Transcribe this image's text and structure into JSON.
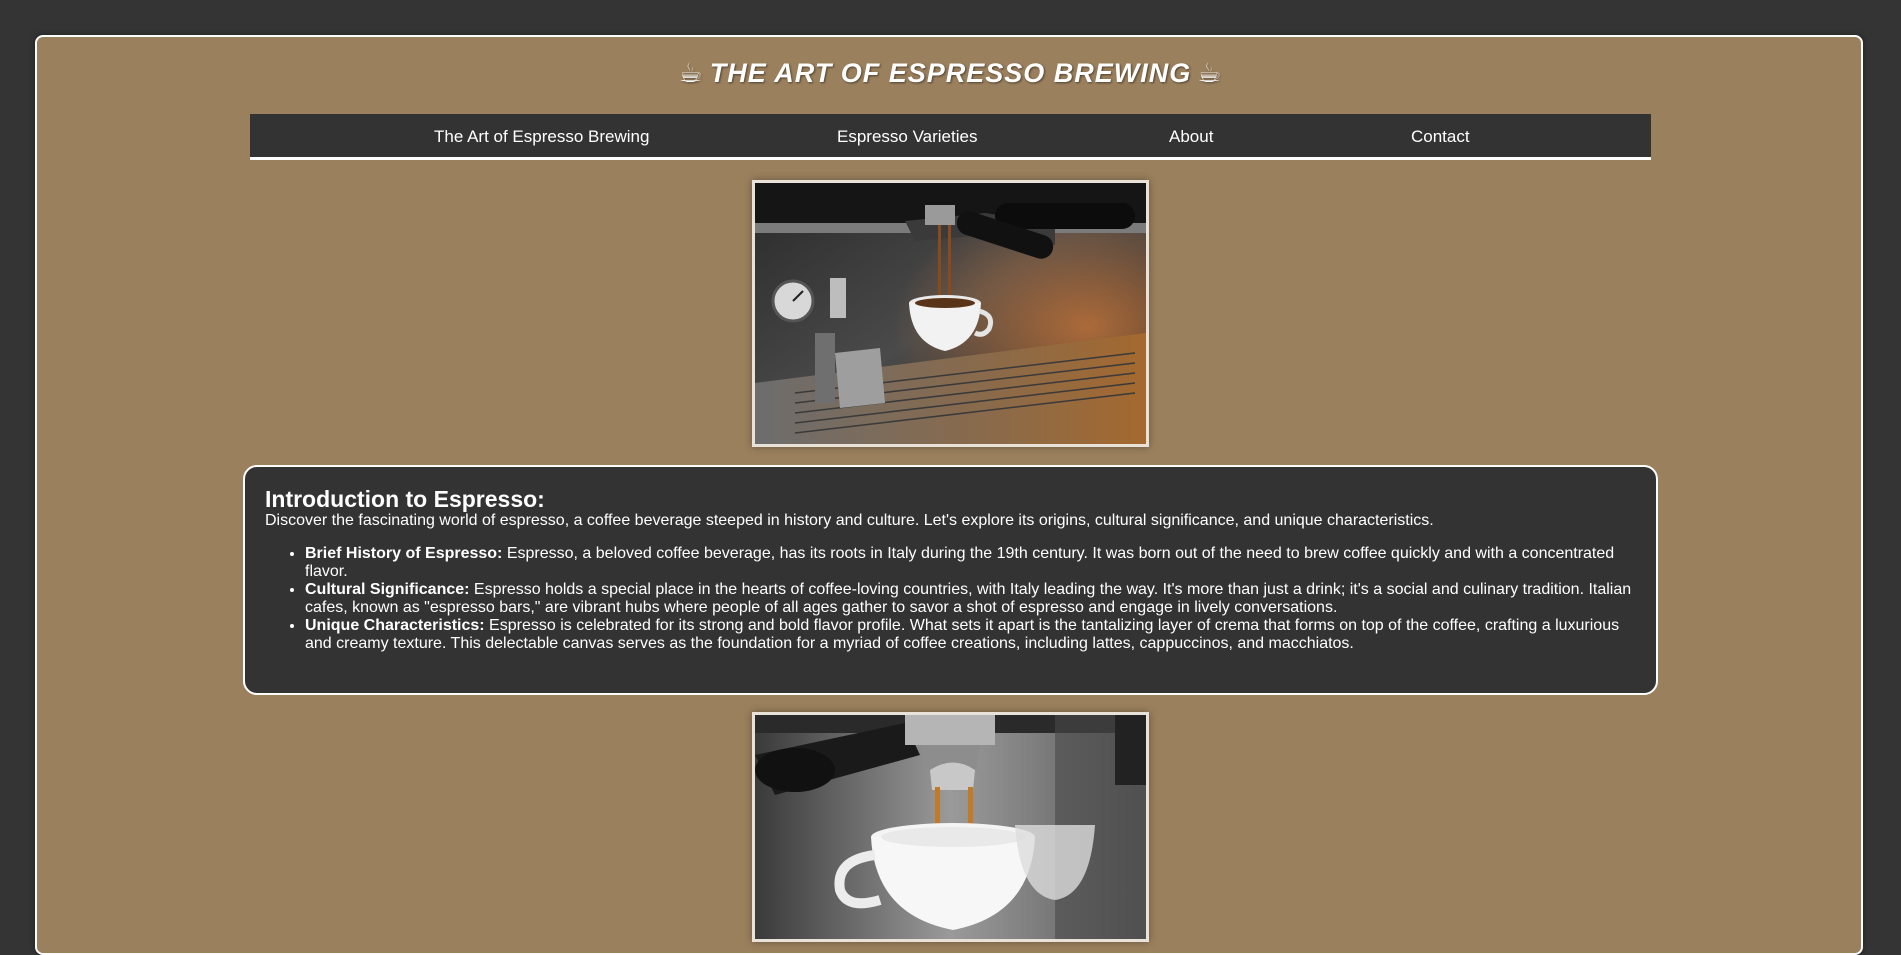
{
  "header": {
    "title": "THE ART OF ESPRESSO BREWING",
    "title_icon": "coffee-cup-icon"
  },
  "nav": {
    "items": [
      {
        "label": "The Art of Espresso Brewing"
      },
      {
        "label": "Espresso Varieties"
      },
      {
        "label": "About"
      },
      {
        "label": "Contact"
      }
    ]
  },
  "images": {
    "top": "espresso-machine-pouring-photo",
    "bottom": "espresso-cup-pouring-closeup-photo"
  },
  "intro": {
    "heading": "Introduction to Espresso:",
    "description": "Discover the fascinating world of espresso, a coffee beverage steeped in history and culture. Let's explore its origins, cultural significance, and unique characteristics.",
    "items": [
      {
        "term": "Brief History of Espresso:",
        "text": " Espresso, a beloved coffee beverage, has its roots in Italy during the 19th century. It was born out of the need to brew coffee quickly and with a concentrated flavor."
      },
      {
        "term": "Cultural Significance:",
        "text": " Espresso holds a special place in the hearts of coffee-loving countries, with Italy leading the way. It's more than just a drink; it's a social and culinary tradition. Italian cafes, known as \"espresso bars,\" are vibrant hubs where people of all ages gather to savor a shot of espresso and engage in lively conversations."
      },
      {
        "term": "Unique Characteristics:",
        "text": " Espresso is celebrated for its strong and bold flavor profile. What sets it apart is the tantalizing layer of crema that forms on top of the coffee, crafting a luxurious and creamy texture. This delectable canvas serves as the foundation for a myriad of coffee creations, including lattes, cappuccinos, and macchiatos."
      }
    ]
  },
  "colors": {
    "page_bg": "#343434",
    "frame_bg": "#9b805d",
    "panel_bg": "#333333",
    "text": "#ffffff"
  }
}
